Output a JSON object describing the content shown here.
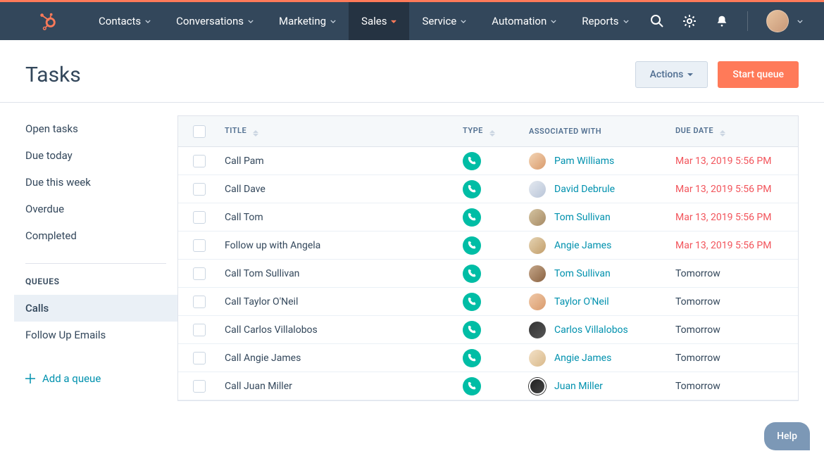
{
  "nav": {
    "items": [
      {
        "label": "Contacts",
        "active": false
      },
      {
        "label": "Conversations",
        "active": false
      },
      {
        "label": "Marketing",
        "active": false
      },
      {
        "label": "Sales",
        "active": true
      },
      {
        "label": "Service",
        "active": false
      },
      {
        "label": "Automation",
        "active": false
      },
      {
        "label": "Reports",
        "active": false
      }
    ]
  },
  "page": {
    "title": "Tasks",
    "actions_label": "Actions",
    "start_queue_label": "Start queue"
  },
  "sidebar": {
    "filters": [
      {
        "label": "Open tasks"
      },
      {
        "label": "Due today"
      },
      {
        "label": "Due this week"
      },
      {
        "label": "Overdue"
      },
      {
        "label": "Completed"
      }
    ],
    "queues_heading": "QUEUES",
    "queues": [
      {
        "label": "Calls",
        "active": true
      },
      {
        "label": "Follow Up Emails",
        "active": false
      }
    ],
    "add_queue_label": "Add a queue"
  },
  "table": {
    "columns": {
      "title": "TITLE",
      "type": "TYPE",
      "associated": "ASSOCIATED WITH",
      "due": "DUE DATE"
    },
    "rows": [
      {
        "title": "Call Pam",
        "contact": "Pam Williams",
        "due": "Mar 13, 2019 5:56 PM",
        "overdue": true,
        "avatar": "av1"
      },
      {
        "title": "Call Dave",
        "contact": "David Debrule",
        "due": "Mar 13, 2019 5:56 PM",
        "overdue": true,
        "avatar": "av2"
      },
      {
        "title": "Call Tom",
        "contact": "Tom Sullivan",
        "due": "Mar 13, 2019 5:56 PM",
        "overdue": true,
        "avatar": "av3"
      },
      {
        "title": "Follow up with Angela",
        "contact": "Angie James",
        "due": "Mar 13, 2019 5:56 PM",
        "overdue": true,
        "avatar": "av4"
      },
      {
        "title": "Call Tom Sullivan",
        "contact": "Tom Sullivan",
        "due": "Tomorrow",
        "overdue": false,
        "avatar": "av5"
      },
      {
        "title": "Call Taylor O'Neil",
        "contact": "Taylor O'Neil",
        "due": "Tomorrow",
        "overdue": false,
        "avatar": "av6"
      },
      {
        "title": "Call Carlos Villalobos",
        "contact": "Carlos Villalobos",
        "due": "Tomorrow",
        "overdue": false,
        "avatar": "av7"
      },
      {
        "title": "Call Angie James",
        "contact": "Angie James",
        "due": "Tomorrow",
        "overdue": false,
        "avatar": "av8"
      },
      {
        "title": "Call Juan Miller",
        "contact": "Juan Miller",
        "due": "Tomorrow",
        "overdue": false,
        "avatar": "av9"
      }
    ]
  },
  "help": {
    "label": "Help"
  }
}
